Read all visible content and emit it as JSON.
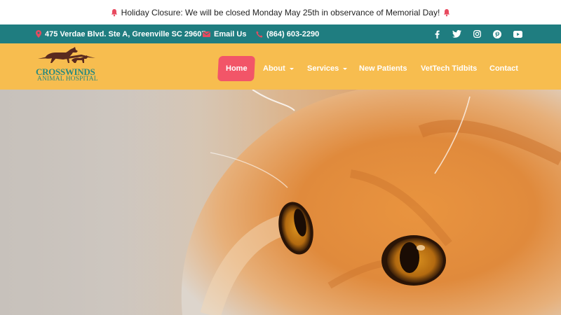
{
  "announcement": {
    "text": "Holiday Closure: We will be closed Monday May 25th in observance of Memorial Day!",
    "icon": "bell-icon",
    "icon_color": "#e84a5f"
  },
  "topbar": {
    "address": "475 Verdae Blvd. Ste A, Greenville SC 29607",
    "email_label": "Email Us",
    "phone": "(864) 603-2290",
    "background": "#1f7d80",
    "social": [
      "facebook-icon",
      "twitter-icon",
      "instagram-icon",
      "pinterest-icon",
      "youtube-icon"
    ]
  },
  "logo": {
    "line1": "CROSSWINDS",
    "line2": "ANIMAL HOSPITAL"
  },
  "nav": {
    "background": "#f7bd4f",
    "active_color": "#f25568",
    "items": [
      {
        "label": "Home"
      },
      {
        "label": "About"
      },
      {
        "label": "Services"
      },
      {
        "label": "New Patients"
      },
      {
        "label": "VetTech Tidbits"
      },
      {
        "label": "Contact"
      }
    ]
  },
  "hero": {
    "subject": "orange tabby cat close-up"
  }
}
